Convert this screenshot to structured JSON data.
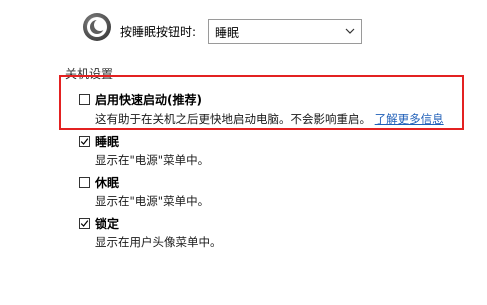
{
  "sleep_row": {
    "icon": "power-sleep-icon",
    "label": "按睡眠按钮时:",
    "dropdown_value": "睡眠"
  },
  "shutdown_settings": {
    "title": "关机设置",
    "options": [
      {
        "label": "启用快速启动(推荐)",
        "checked": false,
        "description": "这有助于在关机之后更快地启动电脑。不会影响重启。",
        "link_text": "了解更多信息"
      },
      {
        "label": "睡眠",
        "checked": true,
        "description": "显示在\"电源\"菜单中。"
      },
      {
        "label": "休眠",
        "checked": false,
        "description": "显示在\"电源\"菜单中。"
      },
      {
        "label": "锁定",
        "checked": true,
        "description": "显示在用户头像菜单中。"
      }
    ]
  },
  "colors": {
    "highlight": "#e32121",
    "link": "#1f5fb8"
  }
}
